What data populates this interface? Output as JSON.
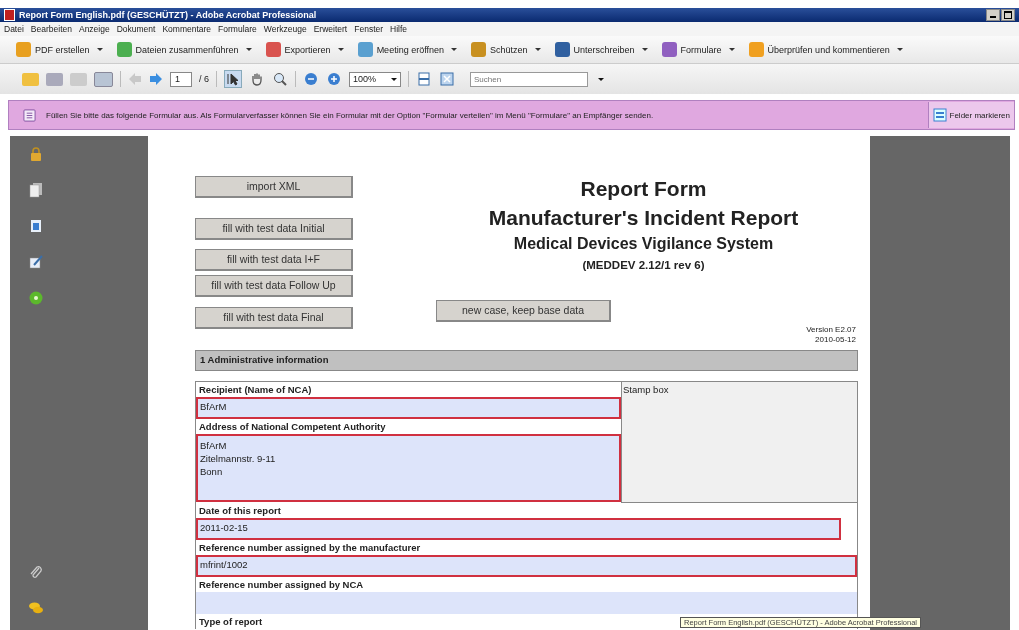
{
  "window": {
    "title": "Report Form English.pdf (GESCHÜTZT) - Adobe Acrobat Professional"
  },
  "menu": [
    "Datei",
    "Bearbeiten",
    "Anzeige",
    "Dokument",
    "Kommentare",
    "Formulare",
    "Werkzeuge",
    "Erweitert",
    "Fenster",
    "Hilfe"
  ],
  "toolbar": [
    {
      "label": "PDF erstellen",
      "kind": "create"
    },
    {
      "label": "Dateien zusammenführen",
      "kind": "merge"
    },
    {
      "label": "Exportieren",
      "kind": "export"
    },
    {
      "label": "Meeting eröffnen",
      "kind": "meeting"
    },
    {
      "label": "Schützen",
      "kind": "lock"
    },
    {
      "label": "Unterschreiben",
      "kind": "pen"
    },
    {
      "label": "Formulare",
      "kind": "form"
    },
    {
      "label": "Überprüfen und kommentieren",
      "kind": "review"
    }
  ],
  "navigation": {
    "page": "1",
    "page_count": "/ 6",
    "zoom": "100%",
    "search": {
      "placeholder": "Suchen"
    }
  },
  "notice": {
    "text": "Füllen Sie bitte das folgende Formular aus. Als Formularverfasser können Sie ein Formular mit der Option \"Formular verteilen\" im Menü \"Formulare\" an Empfänger senden.",
    "button": "Felder markieren"
  },
  "document": {
    "buttons": [
      "import XML",
      "fill with test data Initial",
      "fill with test data I+F",
      "fill with test data Follow Up",
      "fill with test data Final"
    ],
    "title": "Report Form",
    "subtitle": "Manufacturer's Incident Report",
    "system": "Medical Devices Vigilance System",
    "reference": "(MEDDEV 2.12/1 rev 6)",
    "new_case_button": "new case, keep base data",
    "version": "Version E2.07",
    "version_date": "2010-05-12",
    "section": "1 Administrative information",
    "stamp_box": "Stamp box",
    "top_fields": [
      {
        "label": "Recipient (Name of NCA)",
        "value": [
          "BfArM"
        ],
        "required": true,
        "kind": "line"
      },
      {
        "label": "Address of National Competent Authority",
        "value": [
          "BfArM",
          "Zitelmannstr. 9-11",
          "Bonn"
        ],
        "required": true,
        "kind": "area"
      }
    ],
    "fields": [
      {
        "label": "Date of this report",
        "value": "2011-02-15",
        "required": true,
        "kind": "short"
      },
      {
        "label": "Reference number assigned by the manufacturer",
        "value": "mfrint/1002",
        "required": true,
        "kind": "line"
      },
      {
        "label": "Reference number assigned by NCA",
        "required": false,
        "kind": "line"
      }
    ],
    "next_label": "Type of report"
  },
  "tooltip": "Report Form English.pdf (GESCHÜTZT) - Adobe Acrobat Professional"
}
